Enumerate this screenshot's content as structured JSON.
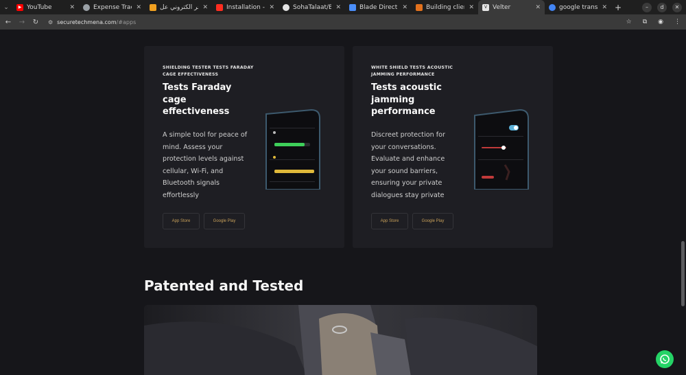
{
  "browser": {
    "tabs": [
      {
        "title": "YouTube",
        "icon": "youtube-icon",
        "color": "#ff0000"
      },
      {
        "title": "Expense Tracker",
        "icon": "globe-icon",
        "color": "#9aa0a6"
      },
      {
        "title": "متجر الكتروني عل",
        "icon": "bookmark-icon",
        "color": "#f0a020"
      },
      {
        "title": "Installation - Lar",
        "icon": "laravel-icon",
        "color": "#ff2d20"
      },
      {
        "title": "SohaTalaat/Exp",
        "icon": "github-icon",
        "color": "#e6e6e6"
      },
      {
        "title": "Blade Directives",
        "icon": "blade-icon",
        "color": "#4a8df8"
      },
      {
        "title": "Building client-s",
        "icon": "fox-icon",
        "color": "#e2711d"
      },
      {
        "title": "Velter",
        "icon": "velter-icon",
        "color": "#e6e6e6"
      },
      {
        "title": "google translate",
        "icon": "google-icon",
        "color": "#4285f4"
      }
    ],
    "url_host": "securetechmena.com",
    "url_path": "/#apps",
    "profile_initial": "d"
  },
  "cards": [
    {
      "eyebrow": "SHIELDING TESTER TESTS FARADAY CAGE EFFECTIVENESS",
      "title": "Tests Faraday cage effectiveness",
      "description": "A simple tool for peace of mind. Assess your protection levels against cellular, Wi-Fi, and Bluetooth signals effortlessly",
      "app_store_label": "App Store",
      "google_play_label": "Google Play"
    },
    {
      "eyebrow": "WHITE SHIELD TESTS ACOUSTIC JAMMING PERFORMANCE",
      "title": "Tests acoustic jamming performance",
      "description": "Discreet protection for your conversations. Evaluate and enhance your sound barriers, ensuring your private dialogues stay private",
      "app_store_label": "App Store",
      "google_play_label": "Google Play"
    }
  ],
  "section_title": "Patented and Tested",
  "colors": {
    "accent_gold": "#c9a15a",
    "card_bg": "#1e1e23",
    "page_bg": "#16161a",
    "whatsapp": "#25d366"
  }
}
